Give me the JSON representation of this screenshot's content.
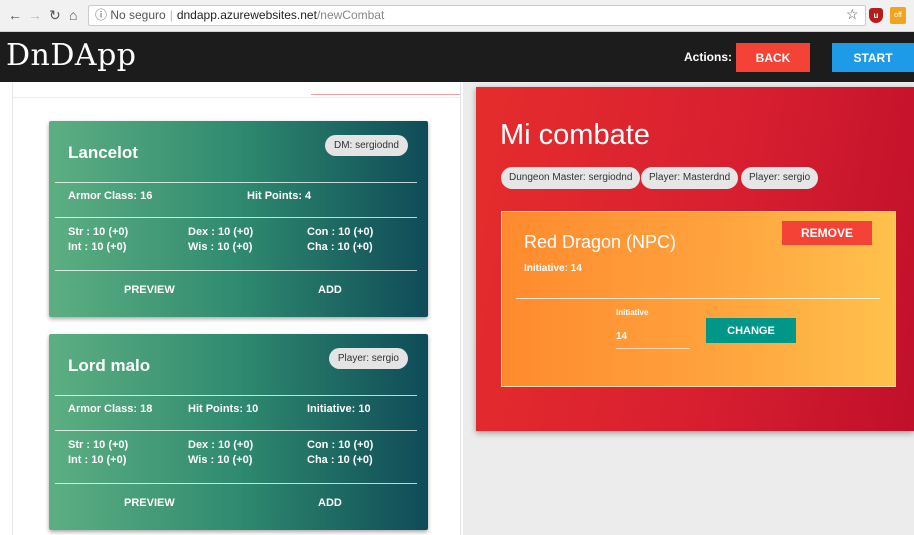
{
  "browser": {
    "security": "ⓘ No seguro",
    "host": "dndapp.azurewebsites.net",
    "path": "/newCombat"
  },
  "header": {
    "logo": "DnDApp",
    "actions_label": "Actions:",
    "back_label": "BACK",
    "start_label": "START"
  },
  "characters": [
    {
      "name": "Lancelot",
      "badge": "DM: sergiodnd",
      "armor_class": "Armor Class: 16",
      "hit_points": "Hit Points: 4",
      "str": "Str : 10 (+0)",
      "dex": "Dex : 10 (+0)",
      "con": "Con : 10 (+0)",
      "int": "Int : 10 (+0)",
      "wis": "Wis : 10 (+0)",
      "cha": "Cha : 10 (+0)",
      "preview_label": "PREVIEW",
      "add_label": "ADD"
    },
    {
      "name": "Lord malo",
      "badge": "Player: sergio",
      "armor_class": "Armor Class: 18",
      "hit_points": "Hit Points: 10",
      "initiative": "Initiative: 10",
      "str": "Str : 10 (+0)",
      "dex": "Dex : 10 (+0)",
      "con": "Con : 10 (+0)",
      "int": "Int : 10 (+0)",
      "wis": "Wis : 10 (+0)",
      "cha": "Cha : 10 (+0)",
      "preview_label": "PREVIEW",
      "add_label": "ADD"
    }
  ],
  "combat": {
    "title": "Mi combate",
    "chips": [
      "Dungeon Master: sergiodnd",
      "Player: Masterdnd",
      "Player: sergio"
    ],
    "participant": {
      "name": "Red Dragon (NPC)",
      "initiative_text": "Initiative: 14",
      "remove_label": "REMOVE",
      "initiative_field_label": "Initiative",
      "initiative_value": "14",
      "change_label": "CHANGE"
    }
  },
  "colors": {
    "header_bg": "#1c1c1c",
    "back_button": "#f44336",
    "start_button": "#1e9be8",
    "combat_panel": "#d81f30",
    "change_button": "#009688"
  }
}
